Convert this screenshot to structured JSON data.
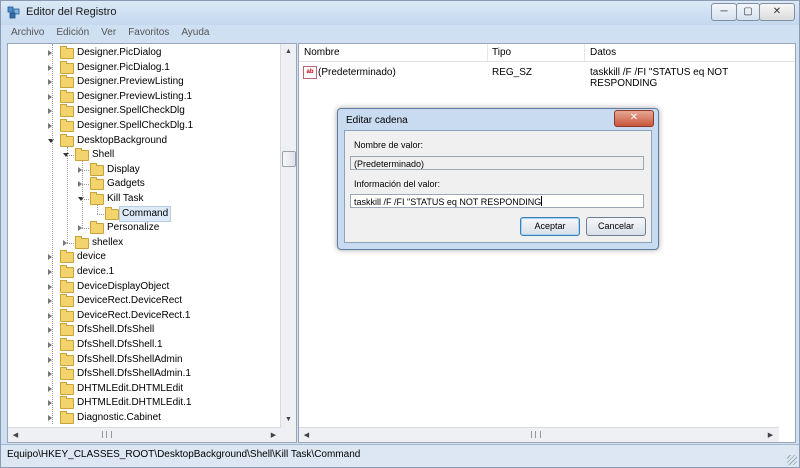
{
  "window": {
    "title": "Editor del Registro",
    "min_glyph": "─",
    "max_glyph": "▢",
    "close_glyph": "✕"
  },
  "menu": [
    {
      "label": "Archivo"
    },
    {
      "label": "Edición"
    },
    {
      "label": "Ver"
    },
    {
      "label": "Favoritos"
    },
    {
      "label": "Ayuda"
    }
  ],
  "tree": {
    "items": [
      {
        "label": "Designer.PicDialog",
        "depth": 0,
        "state": "collapsed"
      },
      {
        "label": "Designer.PicDialog.1",
        "depth": 0,
        "state": "collapsed"
      },
      {
        "label": "Designer.PreviewListing",
        "depth": 0,
        "state": "collapsed"
      },
      {
        "label": "Designer.PreviewListing.1",
        "depth": 0,
        "state": "collapsed"
      },
      {
        "label": "Designer.SpellCheckDlg",
        "depth": 0,
        "state": "collapsed"
      },
      {
        "label": "Designer.SpellCheckDlg.1",
        "depth": 0,
        "state": "collapsed"
      },
      {
        "label": "DesktopBackground",
        "depth": 0,
        "state": "expanded"
      },
      {
        "label": "Shell",
        "depth": 1,
        "state": "expanded"
      },
      {
        "label": "Display",
        "depth": 2,
        "state": "collapsed"
      },
      {
        "label": "Gadgets",
        "depth": 2,
        "state": "collapsed"
      },
      {
        "label": "Kill Task",
        "depth": 2,
        "state": "expanded"
      },
      {
        "label": "Command",
        "depth": 3,
        "state": "leaf",
        "selected": true
      },
      {
        "label": "Personalize",
        "depth": 2,
        "state": "collapsed"
      },
      {
        "label": "shellex",
        "depth": 1,
        "state": "collapsed"
      },
      {
        "label": "device",
        "depth": 0,
        "state": "collapsed"
      },
      {
        "label": "device.1",
        "depth": 0,
        "state": "collapsed"
      },
      {
        "label": "DeviceDisplayObject",
        "depth": 0,
        "state": "collapsed"
      },
      {
        "label": "DeviceRect.DeviceRect",
        "depth": 0,
        "state": "collapsed"
      },
      {
        "label": "DeviceRect.DeviceRect.1",
        "depth": 0,
        "state": "collapsed"
      },
      {
        "label": "DfsShell.DfsShell",
        "depth": 0,
        "state": "collapsed"
      },
      {
        "label": "DfsShell.DfsShell.1",
        "depth": 0,
        "state": "collapsed"
      },
      {
        "label": "DfsShell.DfsShellAdmin",
        "depth": 0,
        "state": "collapsed"
      },
      {
        "label": "DfsShell.DfsShellAdmin.1",
        "depth": 0,
        "state": "collapsed"
      },
      {
        "label": "DHTMLEdit.DHTMLEdit",
        "depth": 0,
        "state": "collapsed"
      },
      {
        "label": "DHTMLEdit.DHTMLEdit.1",
        "depth": 0,
        "state": "collapsed"
      },
      {
        "label": "Diagnostic.Cabinet",
        "depth": 0,
        "state": "collapsed"
      }
    ],
    "scroll_position_fraction": 0.26
  },
  "list": {
    "columns": {
      "name": "Nombre",
      "type": "Tipo",
      "data": "Datos"
    },
    "rows": [
      {
        "icon": "string-value-icon",
        "icon_text": "ab",
        "name": "(Predeterminado)",
        "type": "REG_SZ",
        "data": "taskkill /F /FI \"STATUS eq NOT RESPONDING"
      }
    ]
  },
  "dialog": {
    "title": "Editar cadena",
    "close_glyph": "✕",
    "name_label": "Nombre de valor:",
    "name_value": "(Predeterminado)",
    "data_label": "Información del valor:",
    "data_value": "taskkill /F /FI \"STATUS eq NOT RESPONDING",
    "ok_label": "Aceptar",
    "cancel_label": "Cancelar"
  },
  "statusbar": {
    "path": "Equipo\\HKEY_CLASSES_ROOT\\DesktopBackground\\Shell\\Kill Task\\Command"
  }
}
